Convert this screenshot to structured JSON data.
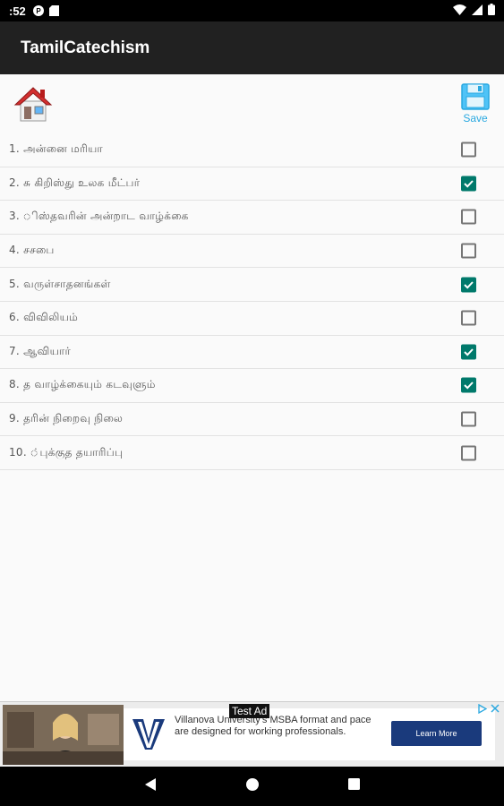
{
  "status_bar": {
    "time": ":52"
  },
  "app_bar": {
    "title": "TamilCatechism"
  },
  "toolbar": {
    "save_label": "Save"
  },
  "items": [
    {
      "label": "1.  அன்னை  மரியா",
      "checked": false
    },
    {
      "label": "2.  சு  கிறிஸ்து  உலக  மீட்பர்",
      "checked": true
    },
    {
      "label": "3. ிஸ்தவரின்  அன்றாட  வாழ்க்கை",
      "checked": false
    },
    {
      "label": "4.  சசபை",
      "checked": false
    },
    {
      "label": "5.  வருள்சாதனங்கள்",
      "checked": true
    },
    {
      "label": "6.  விவிலியம்",
      "checked": false
    },
    {
      "label": "7.     ஆவியார்",
      "checked": true
    },
    {
      "label": "8.  த  வாழ்க்கையும்  கடவுளும்",
      "checked": true
    },
    {
      "label": "9.  தரின்  நிறைவு  நிலை",
      "checked": false
    },
    {
      "label": "10. ்புக்குத  தயாரிப்பு",
      "checked": false
    }
  ],
  "ad": {
    "tag": "Test Ad",
    "text": "Villanova University's MSBA format and pace are designed for working professionals.",
    "cta": "Learn More"
  },
  "colors": {
    "accent": "#00796b",
    "app_bar": "#212121",
    "save_blue": "#29a8e0"
  }
}
